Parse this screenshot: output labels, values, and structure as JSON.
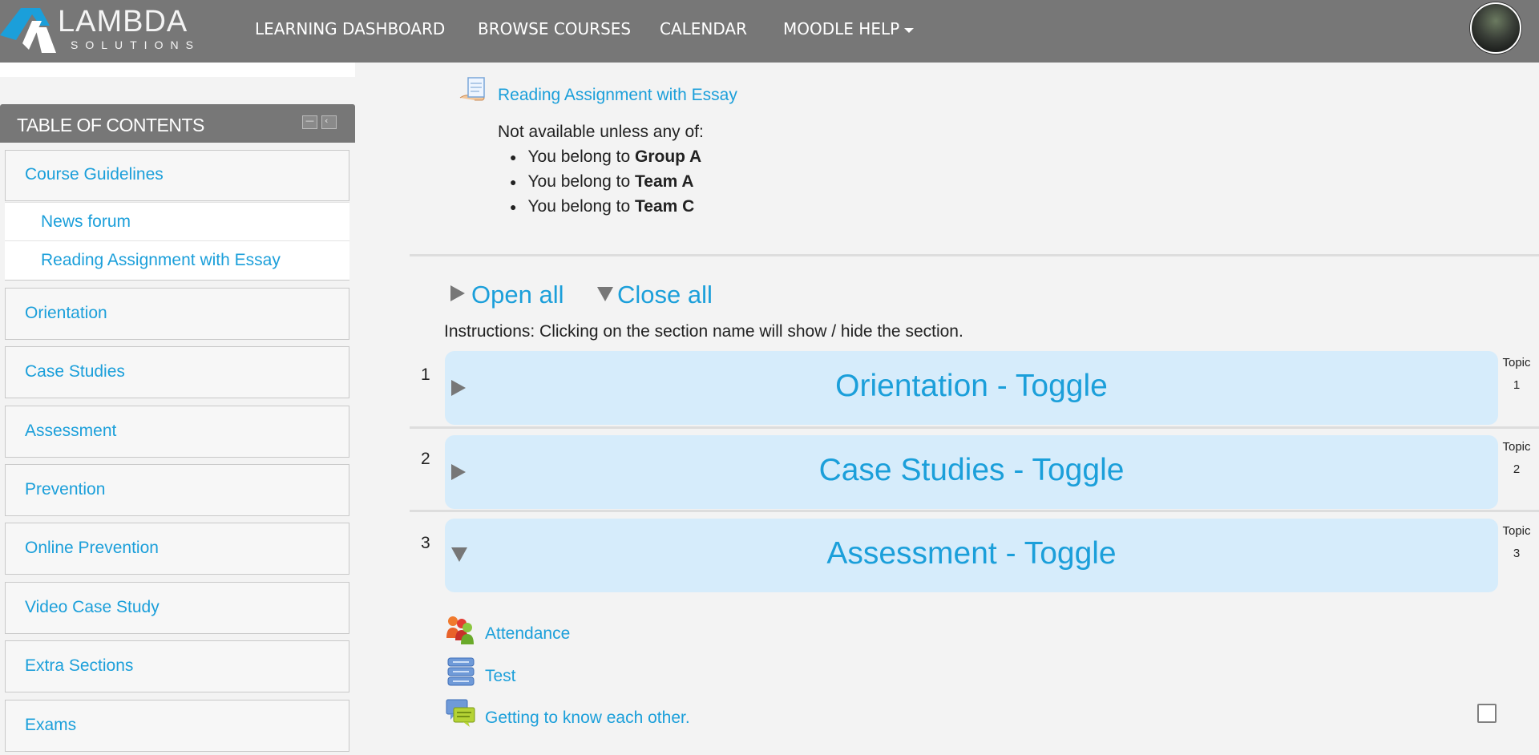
{
  "brand": {
    "word": "LAMBDA",
    "sub": "SOLUTIONS",
    "colors": {
      "accent": "#1b9fda",
      "navbar": "#777777",
      "toggle_bg": "#d6ecfb"
    }
  },
  "nav": {
    "items": [
      {
        "label": "LEARNING DASHBOARD"
      },
      {
        "label": "BROWSE COURSES"
      },
      {
        "label": "CALENDAR"
      },
      {
        "label": "MOODLE HELP"
      }
    ]
  },
  "toc": {
    "title": "TABLE OF CONTENTS",
    "sections": [
      {
        "label": "Course Guidelines",
        "children": [
          {
            "label": "News forum"
          },
          {
            "label": "Reading Assignment with Essay"
          }
        ]
      },
      {
        "label": "Orientation"
      },
      {
        "label": "Case Studies"
      },
      {
        "label": "Assessment"
      },
      {
        "label": "Prevention"
      },
      {
        "label": "Online Prevention"
      },
      {
        "label": "Video Case Study"
      },
      {
        "label": "Extra Sections"
      },
      {
        "label": "Exams"
      }
    ]
  },
  "main": {
    "assignment": {
      "title": "Reading Assignment with Essay",
      "restriction_intro": "Not available unless any of:",
      "restrictions": [
        {
          "prefix": "You belong to ",
          "group": "Group A"
        },
        {
          "prefix": "You belong to ",
          "group": "Team A"
        },
        {
          "prefix": "You belong to ",
          "group": "Team C"
        }
      ]
    },
    "open_all": "Open all",
    "close_all": "Close all",
    "instructions": "Instructions: Clicking on the section name will show / hide the section.",
    "sections": [
      {
        "num": "1",
        "title": "Orientation - Toggle",
        "topic_word": "Topic",
        "topic_num": "1",
        "expanded": false
      },
      {
        "num": "2",
        "title": "Case Studies - Toggle",
        "topic_word": "Topic",
        "topic_num": "2",
        "expanded": false
      },
      {
        "num": "3",
        "title": "Assessment - Toggle",
        "topic_word": "Topic",
        "topic_num": "3",
        "expanded": true
      }
    ],
    "activities": [
      {
        "label": "Attendance",
        "icon": "attendance-icon"
      },
      {
        "label": "Test",
        "icon": "database-icon"
      },
      {
        "label": "Getting to know each other.",
        "icon": "forum-icon"
      }
    ]
  }
}
